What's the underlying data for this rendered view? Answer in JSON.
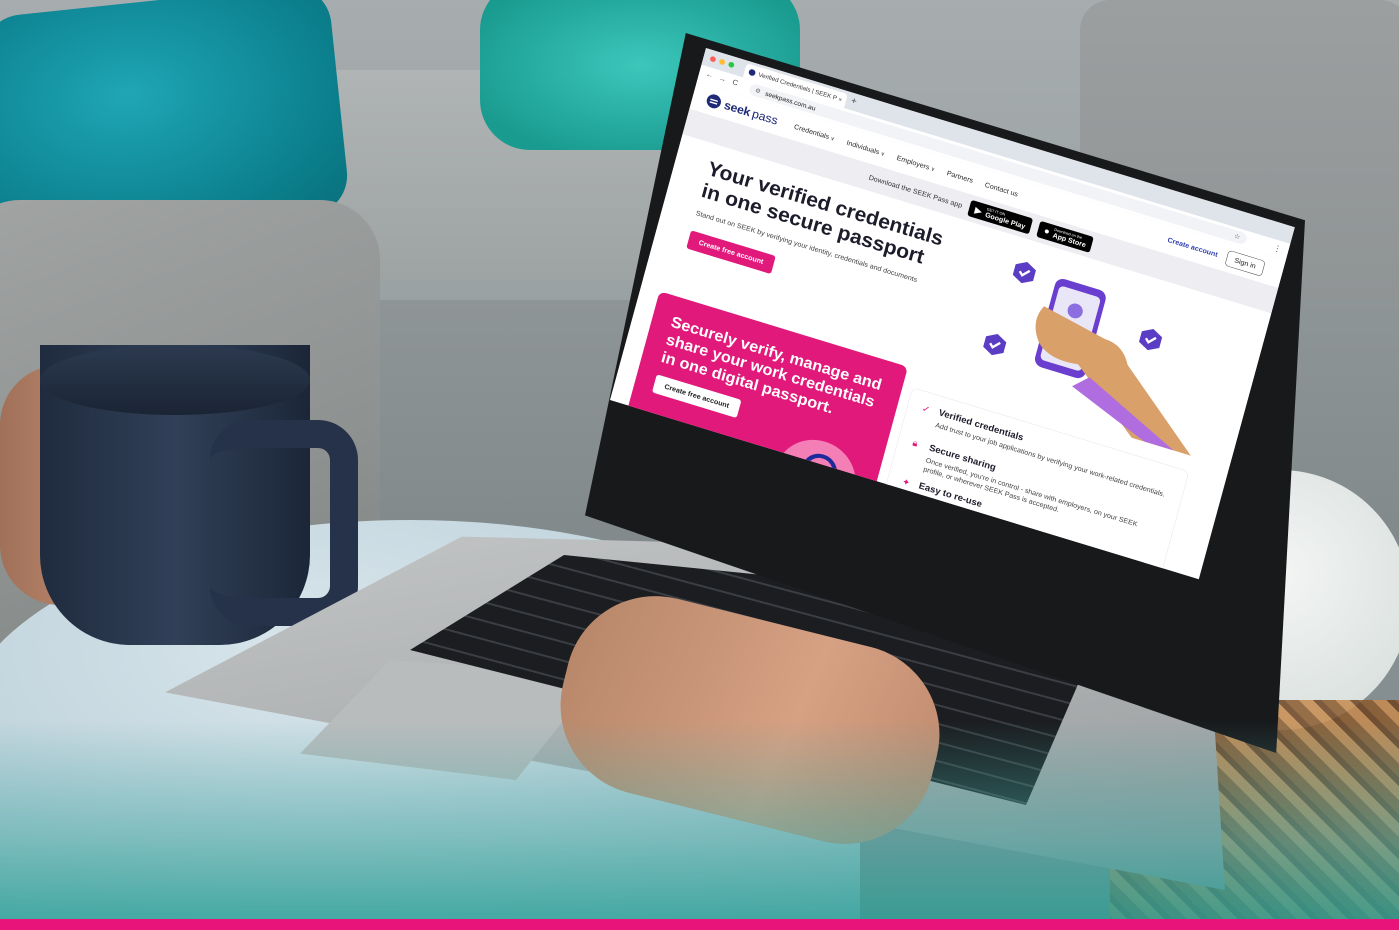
{
  "browser": {
    "tab_title": "Verified Credentials | SEEK P",
    "tab_close": "×",
    "new_tab": "+",
    "url": "seekpass.com.au",
    "back": "←",
    "forward": "→",
    "reload": "C",
    "star": "☆",
    "menu": "⋮"
  },
  "site": {
    "logo_word1": "seek",
    "logo_word2": "pass",
    "nav": [
      {
        "label": "Credentials",
        "dropdown": true
      },
      {
        "label": "Individuals",
        "dropdown": true
      },
      {
        "label": "Employers",
        "dropdown": true
      },
      {
        "label": "Partners",
        "dropdown": false
      },
      {
        "label": "Contact us",
        "dropdown": false
      }
    ],
    "create_account": "Create account",
    "sign_in": "Sign in"
  },
  "app_banner": {
    "text": "Download the SEEK Pass app",
    "google_small": "GET IT ON",
    "google_big": "Google Play",
    "apple_small": "Download on the",
    "apple_big": "App Store"
  },
  "hero": {
    "title": "Your verified credentials in one secure passport",
    "subtitle": "Stand out on SEEK by verifying your identity, credentials and documents",
    "cta": "Create free account"
  },
  "promo": {
    "title": "Securely verify, manage and share your work credentials in one digital passport.",
    "cta": "Create free account"
  },
  "features": [
    {
      "icon": "check-circle-icon",
      "title": "Verified credentials",
      "desc": "Add trust to your job applications by verifying your work-related credentials."
    },
    {
      "icon": "lock-icon",
      "title": "Secure sharing",
      "desc": "Once verified, you're in control - share with employers, on your SEEK profile, or wherever SEEK Pass is accepted."
    },
    {
      "icon": "sparkle-icon",
      "title": "Easy to re-use",
      "desc": ""
    }
  ],
  "colors": {
    "brand_pink": "#e1197a",
    "brand_navy": "#1e2a78",
    "brand_purple": "#6a3fd0",
    "bottom_bar": "#e8147a"
  }
}
